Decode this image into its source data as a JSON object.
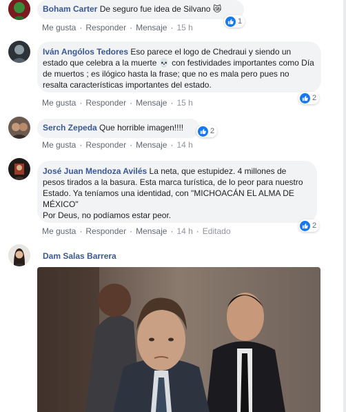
{
  "comments": [
    {
      "author": "Boham Carter",
      "text": "De seguro fue idea de Silvano",
      "emoji": "😿",
      "actions": {
        "like": "Me gusta",
        "reply": "Responder",
        "message": "Mensaje",
        "time": "15 h"
      },
      "reactions": "1"
    },
    {
      "author": "Iván Angólos Tedores",
      "text_part1": "Eso parece el logo de Chedraui y siendo un estado que celebra a la muerte",
      "emoji": "💀",
      "text_part2": "con festividades importantes como Día de muertos ; es ilógico hasta la frase; que no es mala pero pues no resalta características importantes del estado.",
      "actions": {
        "like": "Me gusta",
        "reply": "Responder",
        "message": "Mensaje",
        "time": "15 h"
      },
      "reactions": "2"
    },
    {
      "author": "Serch Zepeda",
      "text": "Que horrible imagen!!!!",
      "actions": {
        "like": "Me gusta",
        "reply": "Responder",
        "message": "Mensaje",
        "time": "14 h"
      },
      "reactions": "2"
    },
    {
      "author": "José Juan Mendoza Avilés",
      "text": "La neta, que estupidez. 4 millones de pesos tirados a la basura. Esta marca turística, de lo peor para nuestro Estado. Ya teníamos una identidad, con \"MICHOACÁN EL ALMA DE MÉXICO\"\nPor Deus, no podíamos estar peor.",
      "actions": {
        "like": "Me gusta",
        "reply": "Responder",
        "message": "Mensaje",
        "time": "14 h",
        "edited": "Editado"
      },
      "reactions": "2"
    },
    {
      "author": "Dam Salas Barrera"
    }
  ],
  "colors": {
    "author": "#385898",
    "bubble": "#f2f3f5",
    "like": "#1877f2",
    "meta": "#606770"
  }
}
